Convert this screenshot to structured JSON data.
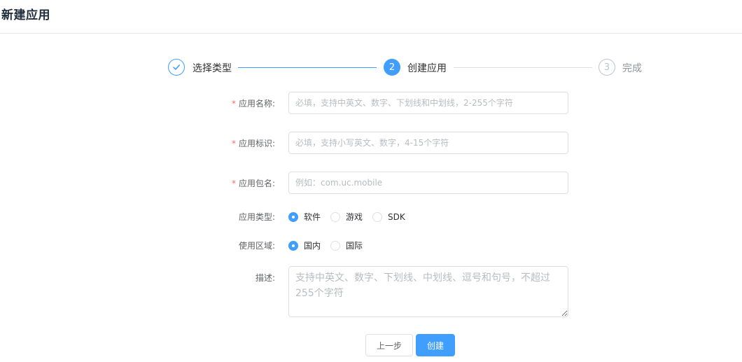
{
  "header": {
    "title": "新建应用"
  },
  "steps": [
    {
      "label": "选择类型",
      "status": "done",
      "icon": "check-icon"
    },
    {
      "number": "2",
      "label": "创建应用",
      "status": "active"
    },
    {
      "number": "3",
      "label": "完成",
      "status": "wait"
    }
  ],
  "form": {
    "app_name": {
      "label": "应用名称:",
      "required_mark": "*",
      "value": "",
      "placeholder": "必填，支持中英文、数字、下划线和中划线，2-255个字符"
    },
    "app_id": {
      "label": "应用标识:",
      "required_mark": "*",
      "value": "",
      "placeholder": "必填，支持小写英文、数字，4-15个字符"
    },
    "package": {
      "label": "应用包名:",
      "required_mark": "*",
      "value": "",
      "placeholder": "例如：com.uc.mobile"
    },
    "app_type": {
      "label": "应用类型:",
      "options": [
        "软件",
        "游戏",
        "SDK"
      ],
      "selected": "软件"
    },
    "region": {
      "label": "使用区域:",
      "options": [
        "国内",
        "国际"
      ],
      "selected": "国内"
    },
    "description": {
      "label": "描述:",
      "value": "",
      "placeholder": "支持中英文、数字、下划线、中划线、逗号和句号，不超过255个字符"
    }
  },
  "actions": {
    "prev_label": "上一步",
    "create_label": "创建"
  },
  "colors": {
    "primary": "#409eff",
    "required": "#f56c6c",
    "border": "#dcdfe6"
  }
}
